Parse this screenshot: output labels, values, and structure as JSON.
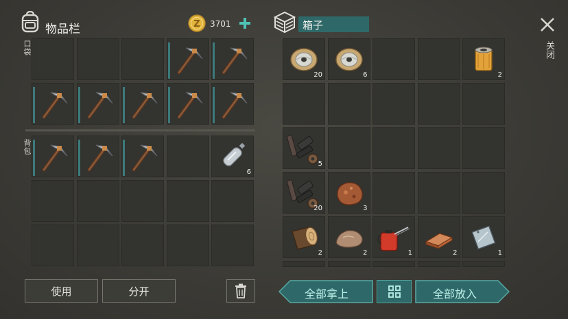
{
  "inventory": {
    "title": "物品栏",
    "currency": "3701",
    "pocket_label": "口袋",
    "backpack_label": "背包",
    "pocket_slots": [
      {
        "item": "empty"
      },
      {
        "item": "empty"
      },
      {
        "item": "empty"
      },
      {
        "item": "pickaxe"
      },
      {
        "item": "pickaxe"
      },
      {
        "item": "pickaxe"
      },
      {
        "item": "pickaxe"
      },
      {
        "item": "pickaxe"
      },
      {
        "item": "pickaxe"
      },
      {
        "item": "pickaxe"
      }
    ],
    "backpack_slots": [
      {
        "item": "pickaxe"
      },
      {
        "item": "pickaxe"
      },
      {
        "item": "pickaxe"
      },
      {
        "item": "empty"
      },
      {
        "item": "plastic-bottle",
        "count": "6"
      },
      {
        "item": "empty"
      },
      {
        "item": "empty"
      },
      {
        "item": "empty"
      },
      {
        "item": "empty"
      },
      {
        "item": "empty"
      },
      {
        "item": "empty"
      },
      {
        "item": "empty"
      },
      {
        "item": "empty"
      },
      {
        "item": "empty"
      },
      {
        "item": "empty"
      }
    ],
    "use_label": "使用",
    "split_label": "分开"
  },
  "box": {
    "title": "箱子",
    "slots": [
      {
        "item": "wire-spool",
        "count": "20"
      },
      {
        "item": "wire-spool",
        "count": "6"
      },
      {
        "item": "empty"
      },
      {
        "item": "empty"
      },
      {
        "item": "oil-filter",
        "count": "2"
      },
      {
        "item": "empty"
      },
      {
        "item": "empty"
      },
      {
        "item": "empty"
      },
      {
        "item": "empty"
      },
      {
        "item": "empty"
      },
      {
        "item": "spare-parts",
        "count": "5"
      },
      {
        "item": "empty"
      },
      {
        "item": "empty"
      },
      {
        "item": "empty"
      },
      {
        "item": "empty"
      },
      {
        "item": "spare-parts",
        "count": "20"
      },
      {
        "item": "copper-ore",
        "count": "3"
      },
      {
        "item": "empty"
      },
      {
        "item": "empty"
      },
      {
        "item": "empty"
      },
      {
        "item": "wood-log",
        "count": "2"
      },
      {
        "item": "stone",
        "count": "2"
      },
      {
        "item": "oil-can",
        "count": "1"
      },
      {
        "item": "copper-bar",
        "count": "2"
      },
      {
        "item": "iron-plate",
        "count": "1"
      }
    ],
    "take_all_label": "全部拿上",
    "put_all_label": "全部放入"
  },
  "close_label": "关闭",
  "colors": {
    "accent": "#2f6868",
    "durability": "#3c7a7c",
    "coin": "#e2b43c"
  }
}
